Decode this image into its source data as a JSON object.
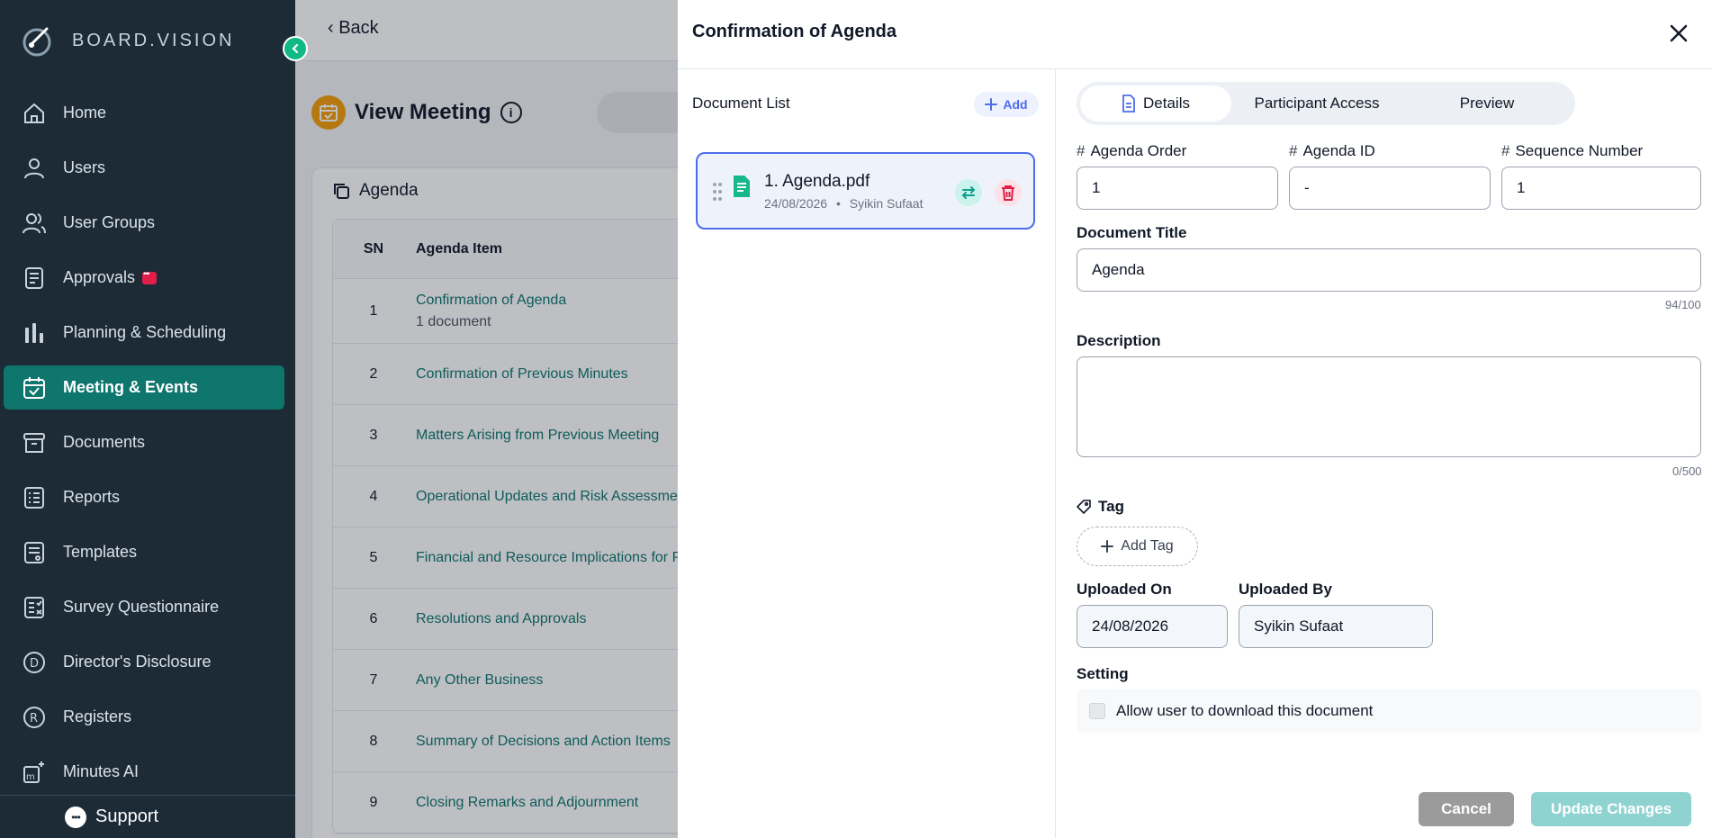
{
  "brand": {
    "name": "BOARD.VISION"
  },
  "sidebar": {
    "items": [
      {
        "label": "Home",
        "icon": "home-icon"
      },
      {
        "label": "Users",
        "icon": "user-icon"
      },
      {
        "label": "User Groups",
        "icon": "users-icon"
      },
      {
        "label": "Approvals",
        "icon": "approvals-icon"
      },
      {
        "label": "Planning & Scheduling",
        "icon": "bar-chart-icon"
      },
      {
        "label": "Meeting & Events",
        "icon": "calendar-check-icon",
        "active": true
      },
      {
        "label": "Documents",
        "icon": "archive-icon"
      },
      {
        "label": "Reports",
        "icon": "list-icon"
      },
      {
        "label": "Templates",
        "icon": "template-icon"
      },
      {
        "label": "Survey Questionnaire",
        "icon": "survey-icon"
      },
      {
        "label": "Director's Disclosure",
        "icon": "d-circle-icon"
      },
      {
        "label": "Registers",
        "icon": "r-circle-icon"
      },
      {
        "label": "Minutes AI",
        "icon": "minutes-ai-icon"
      }
    ],
    "support_label": "Support"
  },
  "page": {
    "back_label": "Back",
    "title": "View Meeting",
    "agenda_card_title": "Agenda",
    "table": {
      "headers": {
        "sn": "SN",
        "item": "Agenda Item"
      },
      "rows": [
        {
          "sn": "1",
          "item": "Confirmation of Agenda",
          "sub": "1 document"
        },
        {
          "sn": "2",
          "item": "Confirmation of Previous Minutes",
          "sub": ""
        },
        {
          "sn": "3",
          "item": "Matters Arising from Previous Meeting",
          "sub": ""
        },
        {
          "sn": "4",
          "item": "Operational Updates and Risk Assessment",
          "sub": ""
        },
        {
          "sn": "5",
          "item": "Financial and Resource Implications for Proposed Actions",
          "sub": ""
        },
        {
          "sn": "6",
          "item": "Resolutions and Approvals",
          "sub": ""
        },
        {
          "sn": "7",
          "item": "Any Other Business",
          "sub": ""
        },
        {
          "sn": "8",
          "item": "Summary of Decisions and Action Items",
          "sub": ""
        },
        {
          "sn": "9",
          "item": "Closing Remarks and Adjournment",
          "sub": ""
        }
      ]
    }
  },
  "drawer": {
    "title": "Confirmation of Agenda",
    "doc_list_label": "Document List",
    "add_label": "Add",
    "document": {
      "name": "1. Agenda.pdf",
      "date": "24/08/2026",
      "separator": "•",
      "uploader": "Syikin Sufaat"
    },
    "tabs": {
      "details": "Details",
      "participant_access": "Participant Access",
      "preview": "Preview"
    },
    "form": {
      "agenda_order_label": "Agenda Order",
      "agenda_order_value": "1",
      "agenda_id_label": "Agenda ID",
      "agenda_id_value": "-",
      "sequence_label": "Sequence Number",
      "sequence_value": "1",
      "hash": "#",
      "doc_title_label": "Document Title",
      "doc_title_value": "Agenda",
      "doc_title_counter": "94/100",
      "description_label": "Description",
      "description_counter": "0/500",
      "tag_label": "Tag",
      "add_tag_label": "Add Tag",
      "uploaded_on_label": "Uploaded On",
      "uploaded_on_value": "24/08/2026",
      "uploaded_by_label": "Uploaded By",
      "uploaded_by_value": "Syikin Sufaat",
      "setting_label": "Setting",
      "allow_download_label": "Allow user to download this document"
    },
    "buttons": {
      "cancel": "Cancel",
      "update": "Update Changes"
    }
  },
  "colors": {
    "sidebar_bg": "#1c2b36",
    "accent": "#0f766e",
    "primary_link": "#4f6bed",
    "update_btn": "#8fd3d0"
  }
}
